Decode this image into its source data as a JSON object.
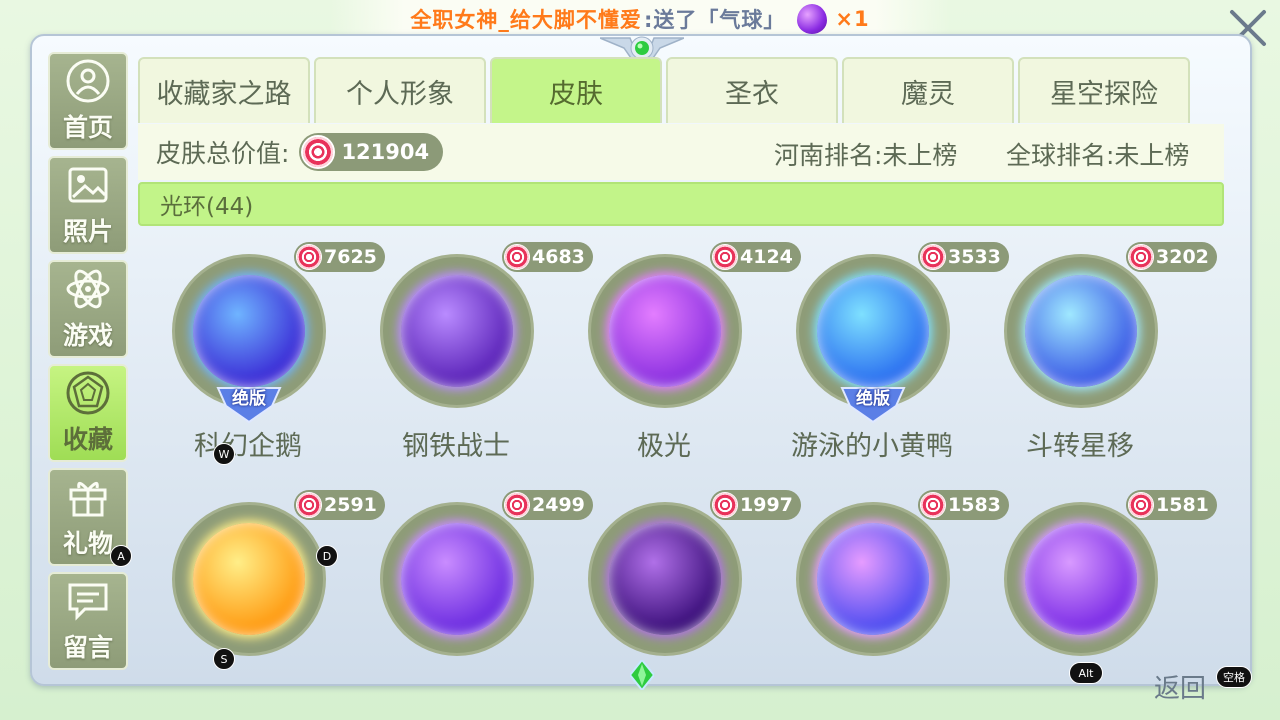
{
  "banner": {
    "sender": "全职女神_给大脚不懂爱",
    "message": ":送了「气球」",
    "gift_icon": "balloon-icon",
    "count": "×1"
  },
  "sidenav": [
    {
      "label": "首页",
      "icon": "home-icon",
      "active": false
    },
    {
      "label": "照片",
      "icon": "photo-icon",
      "active": false
    },
    {
      "label": "游戏",
      "icon": "atom-icon",
      "active": false
    },
    {
      "label": "收藏",
      "icon": "gem-icon",
      "active": true
    },
    {
      "label": "礼物",
      "icon": "gift-icon",
      "active": false
    },
    {
      "label": "留言",
      "icon": "message-icon",
      "active": false
    }
  ],
  "tabs": [
    {
      "label": "收藏家之路",
      "active": false
    },
    {
      "label": "个人形象",
      "active": false
    },
    {
      "label": "皮肤",
      "active": true
    },
    {
      "label": "圣衣",
      "active": false
    },
    {
      "label": "魔灵",
      "active": false
    },
    {
      "label": "星空探险",
      "active": false
    }
  ],
  "info": {
    "total_label": "皮肤总价值:",
    "total_value": "121904",
    "henan_rank": "河南排名:未上榜",
    "global_rank": "全球排名:未上榜"
  },
  "category": {
    "label": "光环(44)"
  },
  "skins": [
    {
      "name": "科幻企鹅",
      "price": "7625",
      "badge": "绝版",
      "color_a": "#6fb4ff",
      "color_b": "#3a2bd6"
    },
    {
      "name": "钢铁战士",
      "price": "4683",
      "badge": "",
      "color_a": "#b98bff",
      "color_b": "#5a22b8"
    },
    {
      "name": "极光",
      "price": "4124",
      "badge": "",
      "color_a": "#e37dff",
      "color_b": "#8a2fe0"
    },
    {
      "name": "游泳的小黄鸭",
      "price": "3533",
      "badge": "绝版",
      "color_a": "#7ee0ff",
      "color_b": "#2a6ff0"
    },
    {
      "name": "斗转星移",
      "price": "3202",
      "badge": "",
      "color_a": "#9fe8ff",
      "color_b": "#3a5ae6"
    },
    {
      "name": "",
      "price": "2591",
      "badge": "",
      "color_a": "#ffee88",
      "color_b": "#ff9a10"
    },
    {
      "name": "",
      "price": "2499",
      "badge": "",
      "color_a": "#c98cff",
      "color_b": "#6a2ae0"
    },
    {
      "name": "",
      "price": "1997",
      "badge": "",
      "color_a": "#b070e8",
      "color_b": "#3a0e7a"
    },
    {
      "name": "",
      "price": "1583",
      "badge": "",
      "color_a": "#e69cff",
      "color_b": "#4a4af0"
    },
    {
      "name": "",
      "price": "1581",
      "badge": "",
      "color_a": "#d89aff",
      "color_b": "#7a2ae6"
    }
  ],
  "hotkeys": {
    "w": "W",
    "a": "A",
    "s": "S",
    "d": "D",
    "alt": "Alt",
    "space": "空格"
  },
  "back_label": "返回"
}
